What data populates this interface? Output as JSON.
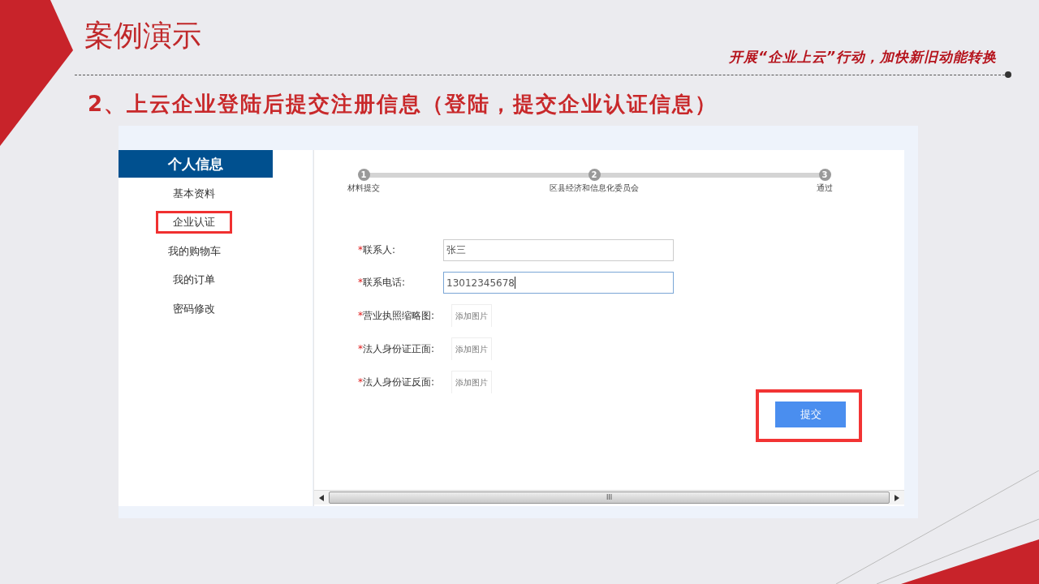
{
  "slide": {
    "title": "案例演示",
    "slogan": "开展“企业上云”行动，加快新旧动能转换",
    "heading": "2、上云企业登陆后提交注册信息（登陆，提交企业认证信息）"
  },
  "sidebar": {
    "header": "个人信息",
    "items": [
      {
        "label": "基本资料",
        "annotated": false
      },
      {
        "label": "企业认证",
        "annotated": true
      },
      {
        "label": "我的购物车",
        "annotated": false
      },
      {
        "label": "我的订单",
        "annotated": false
      },
      {
        "label": "密码修改",
        "annotated": false
      }
    ]
  },
  "steps": [
    {
      "number": "1",
      "label": "材料提交"
    },
    {
      "number": "2",
      "label": "区县经济和信息化委员会"
    },
    {
      "number": "3",
      "label": "通过"
    }
  ],
  "form": {
    "fields": [
      {
        "kind": "text",
        "required_mark": "*",
        "label": "联系人:",
        "value": "张三",
        "focused": false
      },
      {
        "kind": "text",
        "required_mark": "*",
        "label": "联系电话:",
        "value": "13012345678",
        "focused": true
      },
      {
        "kind": "upload",
        "required_mark": "*",
        "label": "营业执照缩略图:",
        "button": "添加图片"
      },
      {
        "kind": "upload",
        "required_mark": "*",
        "label": "法人身份证正面:",
        "button": "添加图片"
      },
      {
        "kind": "upload",
        "required_mark": "*",
        "label": "法人身份证反面:",
        "button": "添加图片"
      }
    ],
    "submit": {
      "label": "提交",
      "annotated": true
    }
  },
  "scrollbar": {
    "grip": "III"
  }
}
